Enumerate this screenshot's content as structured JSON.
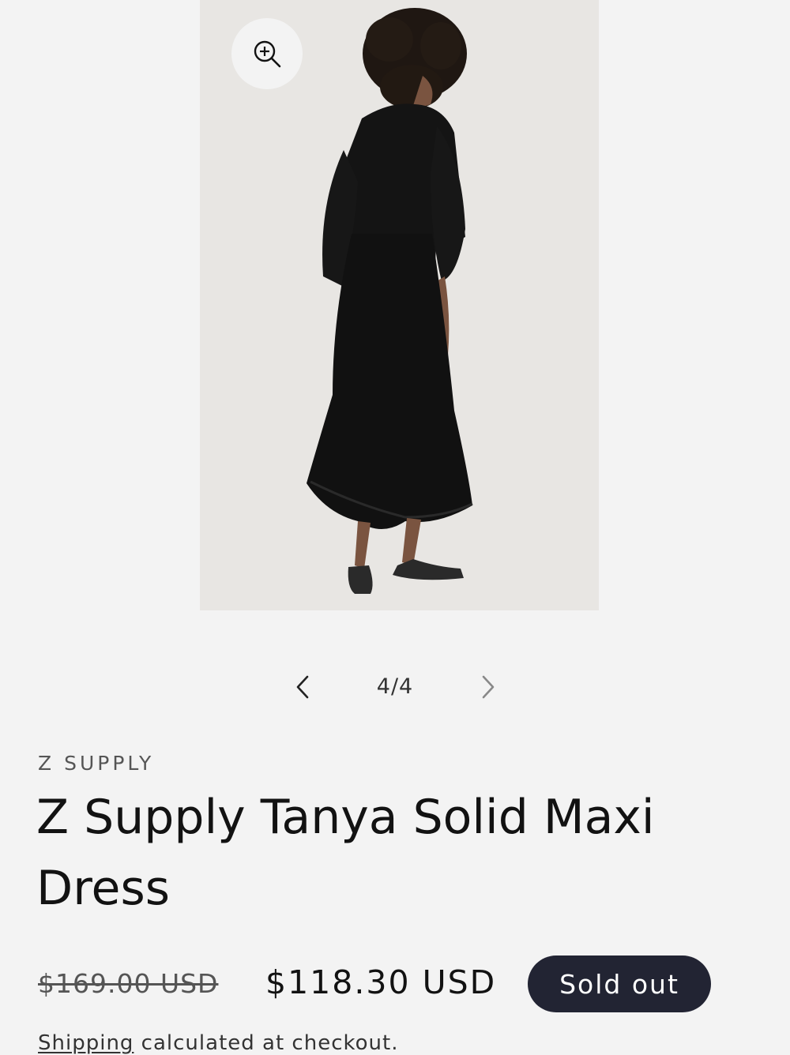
{
  "gallery": {
    "image_alt": "Z Supply Tanya Solid Maxi Dress",
    "zoom_icon": "zoom-in-icon",
    "prev_icon": "chevron-left-icon",
    "next_icon": "chevron-right-icon",
    "counter": "4/4"
  },
  "product": {
    "vendor": "Z SUPPLY",
    "title": "Z Supply Tanya Solid Maxi Dress",
    "compare_price": "$169.00 USD",
    "sale_price": "$118.30 USD",
    "sold_out_label": "Sold out",
    "shipping_link": "Shipping",
    "shipping_rest": " calculated at checkout."
  },
  "colors": {
    "background": "#f3f3f3",
    "badge": "#222433",
    "text": "#121212"
  }
}
